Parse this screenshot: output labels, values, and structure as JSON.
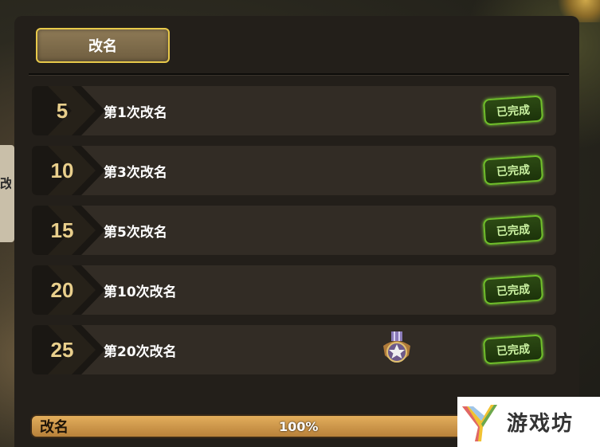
{
  "side_tab": {
    "text": "改昵"
  },
  "tab": {
    "label": "改名"
  },
  "achievements": [
    {
      "level": "5",
      "task": "第1次改名",
      "status": "已完成"
    },
    {
      "level": "10",
      "task": "第3次改名",
      "status": "已完成"
    },
    {
      "level": "15",
      "task": "第5次改名",
      "status": "已完成"
    },
    {
      "level": "20",
      "task": "第10次改名",
      "status": "已完成"
    },
    {
      "level": "25",
      "task": "第20次改名",
      "status": "已完成",
      "reward": "medal-icon"
    }
  ],
  "progress": {
    "label": "改名",
    "value": "100%",
    "fraction": 1.0
  },
  "watermark": {
    "text": "游戏坊"
  },
  "colors": {
    "accent_gold": "#e8c94a",
    "status_green": "#6fbf2a",
    "progress_fill": "#e3ae5c"
  }
}
